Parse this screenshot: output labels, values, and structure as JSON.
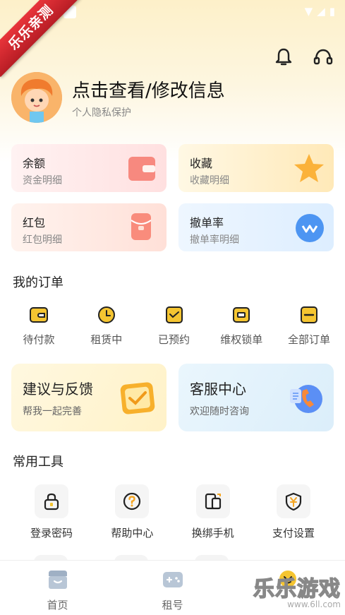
{
  "ribbon": "乐乐亲测",
  "profile": {
    "name": "点击查看/修改信息",
    "subtitle": "个人隐私保护"
  },
  "cards": [
    {
      "title": "余额",
      "subtitle": "资金明细",
      "icon": "wallet-icon"
    },
    {
      "title": "收藏",
      "subtitle": "收藏明细",
      "icon": "star-icon"
    },
    {
      "title": "红包",
      "subtitle": "红包明细",
      "icon": "red-envelope-icon"
    },
    {
      "title": "撤单率",
      "subtitle": "撤单率明细",
      "icon": "wave-badge-icon"
    }
  ],
  "orders_title": "我的订单",
  "orders": [
    {
      "label": "待付款",
      "icon": "wallet-small-icon"
    },
    {
      "label": "租赁中",
      "icon": "clock-icon"
    },
    {
      "label": "已预约",
      "icon": "check-box-icon"
    },
    {
      "label": "维权锁单",
      "icon": "lock-order-icon"
    },
    {
      "label": "全部订单",
      "icon": "all-orders-icon"
    }
  ],
  "features": {
    "feedback": {
      "title": "建议与反馈",
      "subtitle": "帮我一起完善"
    },
    "service": {
      "title": "客服中心",
      "subtitle": "欢迎随时咨询"
    }
  },
  "tools_title": "常用工具",
  "tools": [
    {
      "label": "登录密码",
      "icon": "lock-icon"
    },
    {
      "label": "帮助中心",
      "icon": "help-icon"
    },
    {
      "label": "换绑手机",
      "icon": "phone-swap-icon"
    },
    {
      "label": "支付设置",
      "icon": "shield-yen-icon"
    }
  ],
  "tabbar": [
    {
      "label": "首页",
      "icon": "shop-icon"
    },
    {
      "label": "租号",
      "icon": "gamepad-icon"
    }
  ],
  "watermark": {
    "main": "乐乐游戏",
    "url": "www.6ll.com"
  },
  "colors": {
    "accent_yellow": "#f5c531",
    "dark": "#222222",
    "ribbon_red": "#d62a30"
  }
}
